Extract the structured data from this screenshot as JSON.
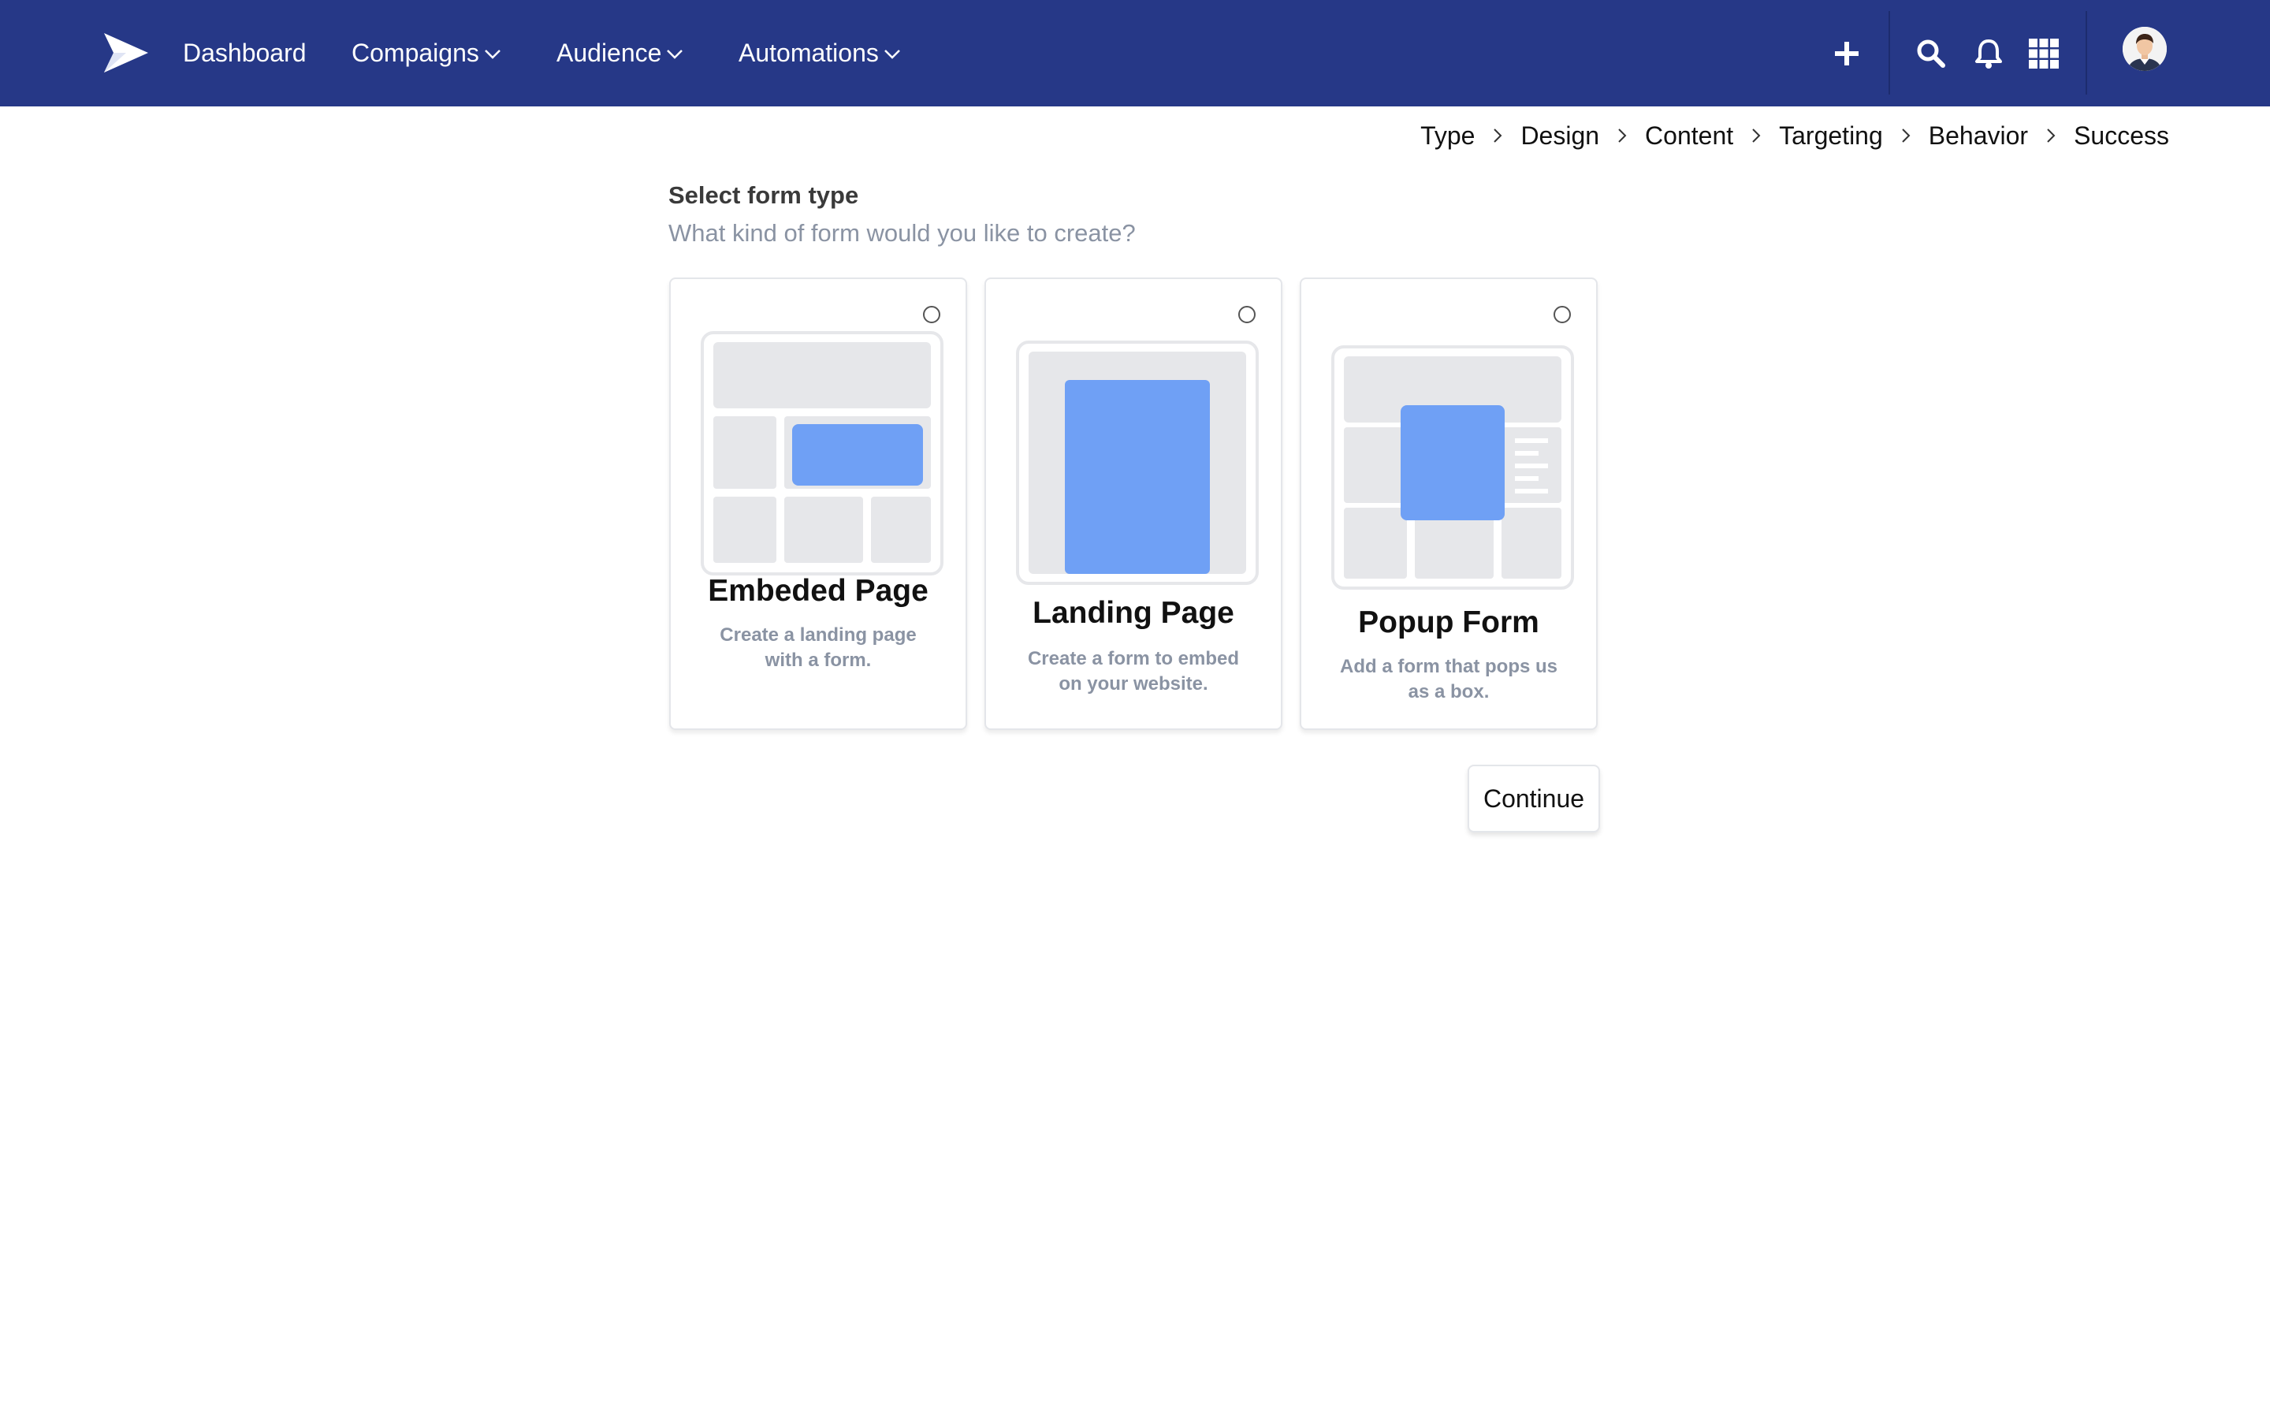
{
  "nav": {
    "items": [
      {
        "label": "Dashboard",
        "has_dropdown": false
      },
      {
        "label": "Compaigns",
        "has_dropdown": true
      },
      {
        "label": "Audience",
        "has_dropdown": true
      },
      {
        "label": "Automations",
        "has_dropdown": true
      }
    ],
    "icons": [
      "plus-icon",
      "search-icon",
      "bell-icon",
      "apps-grid-icon"
    ],
    "colors": {
      "bar": "#263887",
      "text": "#ffffff"
    }
  },
  "steps": [
    "Type",
    "Design",
    "Content",
    "Targeting",
    "Behavior",
    "Success"
  ],
  "form": {
    "heading": "Select form type",
    "subheading": "What kind of form would you like to create?"
  },
  "cards": [
    {
      "title": "Embeded Page",
      "desc": "Create a landing page with a form.",
      "selected": false
    },
    {
      "title": "Landing Page",
      "desc": "Create a form to embed on your website.",
      "selected": false
    },
    {
      "title": "Popup Form",
      "desc": "Add a form that pops us as a box.",
      "selected": false
    }
  ],
  "colors": {
    "accent": "#6fa0f5",
    "panel": "#e6e7ea",
    "muted_text": "#8a93a3"
  },
  "continue_label": "Continue"
}
